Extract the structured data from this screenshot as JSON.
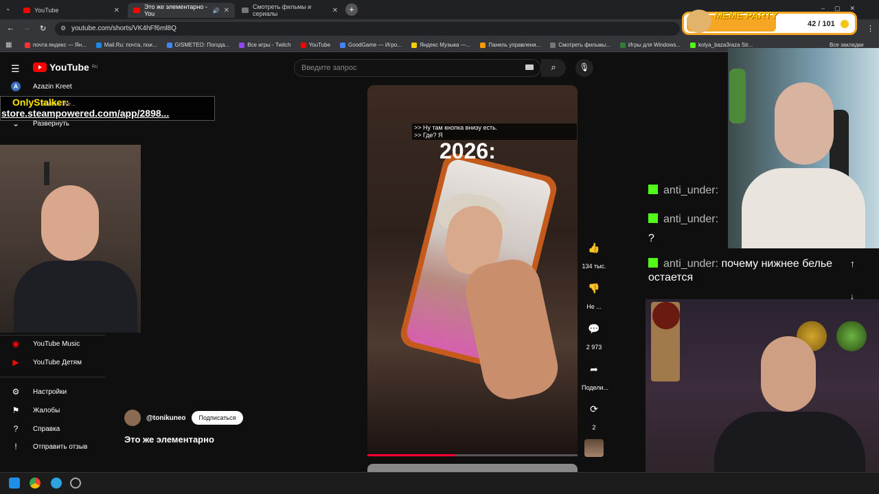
{
  "browser": {
    "tabs": [
      {
        "label": "YouTube",
        "active": false
      },
      {
        "label": "Это же элементарно - You",
        "active": true
      },
      {
        "label": "Смотреть фильмы и сериалы",
        "active": false
      }
    ],
    "url": "youtube.com/shorts/VK4hFf6ml8Q",
    "bookmarks": [
      {
        "label": "почта яндекс — Ян...",
        "color": "#ff3333"
      },
      {
        "label": "Mail.Ru: почта, пои...",
        "color": "#1e88e5"
      },
      {
        "label": "GISMETEO: Погода...",
        "color": "#4285f4"
      },
      {
        "label": "Все игры - Twitch",
        "color": "#9146ff"
      },
      {
        "label": "YouTube",
        "color": "#ff0000"
      },
      {
        "label": "GoodGame — Игро...",
        "color": "#4285f4"
      },
      {
        "label": "Яндекс Музыка —...",
        "color": "#ffcc00"
      },
      {
        "label": "Панель управлени...",
        "color": "#ff9900"
      },
      {
        "label": "Смотреть фильмы...",
        "color": "#777777"
      },
      {
        "label": "Игры для Windows...",
        "color": "#2e7d32"
      },
      {
        "label": "kolya_baza3raza Str...",
        "color": "#53fc18"
      }
    ],
    "all_bookmarks": "Все закладки"
  },
  "youtube": {
    "logo": "YouTube",
    "region": "RU",
    "account": "Azazin Kreet",
    "expand": "Развернуть",
    "search_placeholder": "Введите запрос",
    "side_bottom": [
      {
        "label": "YouTube Music",
        "icon": "youtube-music-icon"
      },
      {
        "label": "YouTube Детям",
        "icon": "youtube-kids-icon"
      }
    ],
    "side_settings": [
      {
        "label": "Настройки",
        "icon": "gear-icon"
      },
      {
        "label": "Жалобы",
        "icon": "flag-icon"
      },
      {
        "label": "Справка",
        "icon": "help-icon"
      },
      {
        "label": "Отправить отзыв",
        "icon": "feedback-icon"
      }
    ],
    "short": {
      "subtitle_line1": ">> Ну там кнопка внизу есть.",
      "subtitle_line2": ">> Где? Я",
      "caption": "2026:",
      "likes": "134 тыс.",
      "dislike": "Не ...",
      "comments": "2 973",
      "share": "Подели...",
      "remix": "2",
      "progress": 0.42
    },
    "channel": "@tonikuneo",
    "subscribe": "Подписаться",
    "title": "Это же элементарно"
  },
  "overlays": {
    "stalker_title": "OnlyStalker:",
    "stalker_url": "store.steampowered.com/app/2898...",
    "stalker_under": "Stalkers We...",
    "meme_party_title": "MEME PARTY",
    "meme_party_count": "42 / 101"
  },
  "chat": [
    {
      "user": "anti_under:",
      "text": ""
    },
    {
      "user": "anti_under:",
      "text": "?"
    },
    {
      "user": "anti_under:",
      "text": "почему нижнее белье остается"
    }
  ]
}
